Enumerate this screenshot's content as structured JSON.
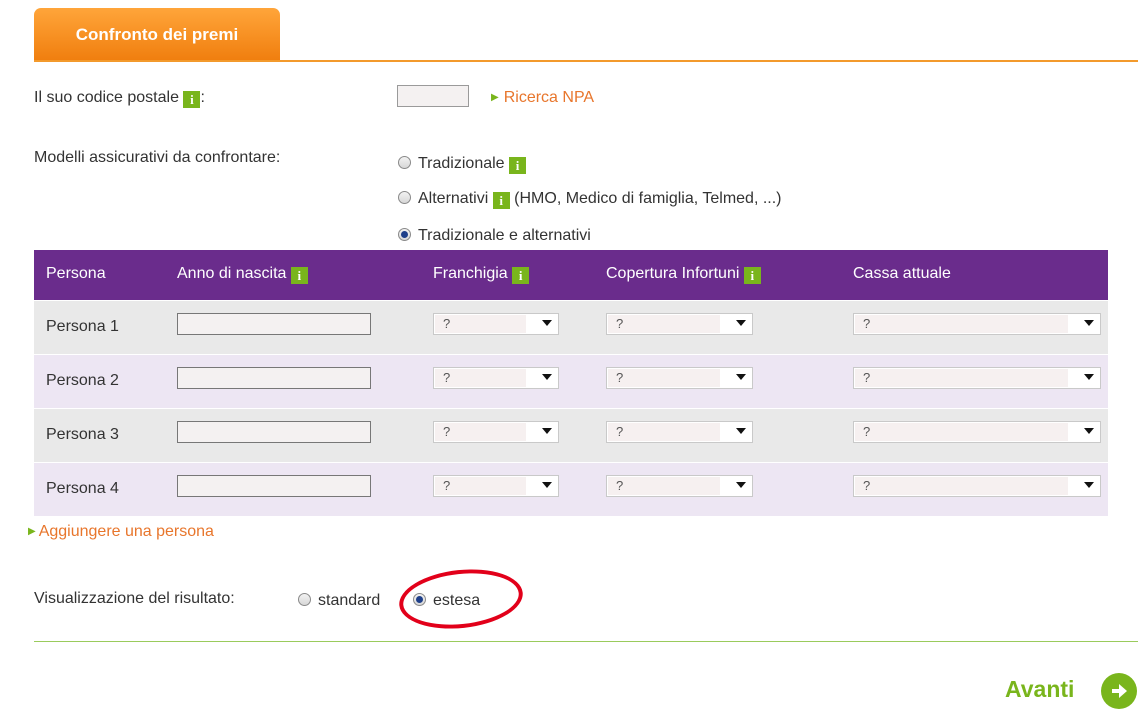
{
  "tab": {
    "label": "Confronto dei premi"
  },
  "postal": {
    "label": "Il suo codice postale",
    "colon": ":",
    "value": "",
    "search_link": "Ricerca NPA"
  },
  "models": {
    "label": "Modelli assicurativi da confrontare:",
    "options": [
      {
        "label": "Tradizionale",
        "suffix": "",
        "checked": false
      },
      {
        "label": "Alternativi",
        "suffix": "(HMO, Medico di famiglia, Telmed, ...)",
        "checked": false
      },
      {
        "label": "Tradizionale e alternativi",
        "suffix": "",
        "checked": true
      }
    ]
  },
  "table": {
    "headers": [
      "Persona",
      "Anno di nascita",
      "Franchigia",
      "Copertura Infortuni",
      "Cassa attuale"
    ],
    "rows": [
      {
        "name": "Persona 1",
        "birth": "",
        "franchigia": "?",
        "copertura": "?",
        "cassa": "?"
      },
      {
        "name": "Persona 2",
        "birth": "",
        "franchigia": "?",
        "copertura": "?",
        "cassa": "?"
      },
      {
        "name": "Persona 3",
        "birth": "",
        "franchigia": "?",
        "copertura": "?",
        "cassa": "?"
      },
      {
        "name": "Persona 4",
        "birth": "",
        "franchigia": "?",
        "copertura": "?",
        "cassa": "?"
      }
    ]
  },
  "add_person": "Aggiungere una persona",
  "result_view": {
    "label": "Visualizzazione del risultato:",
    "options": [
      {
        "label": "standard",
        "checked": false
      },
      {
        "label": "estesa",
        "checked": true
      }
    ]
  },
  "next": {
    "label": "Avanti"
  },
  "info_icon_glyph": "i",
  "colors": {
    "accent_orange": "#f07e0e",
    "header_purple": "#6a2c8c",
    "green": "#79b51c",
    "link_orange": "#e8762c",
    "highlight_red": "#e2001a"
  }
}
